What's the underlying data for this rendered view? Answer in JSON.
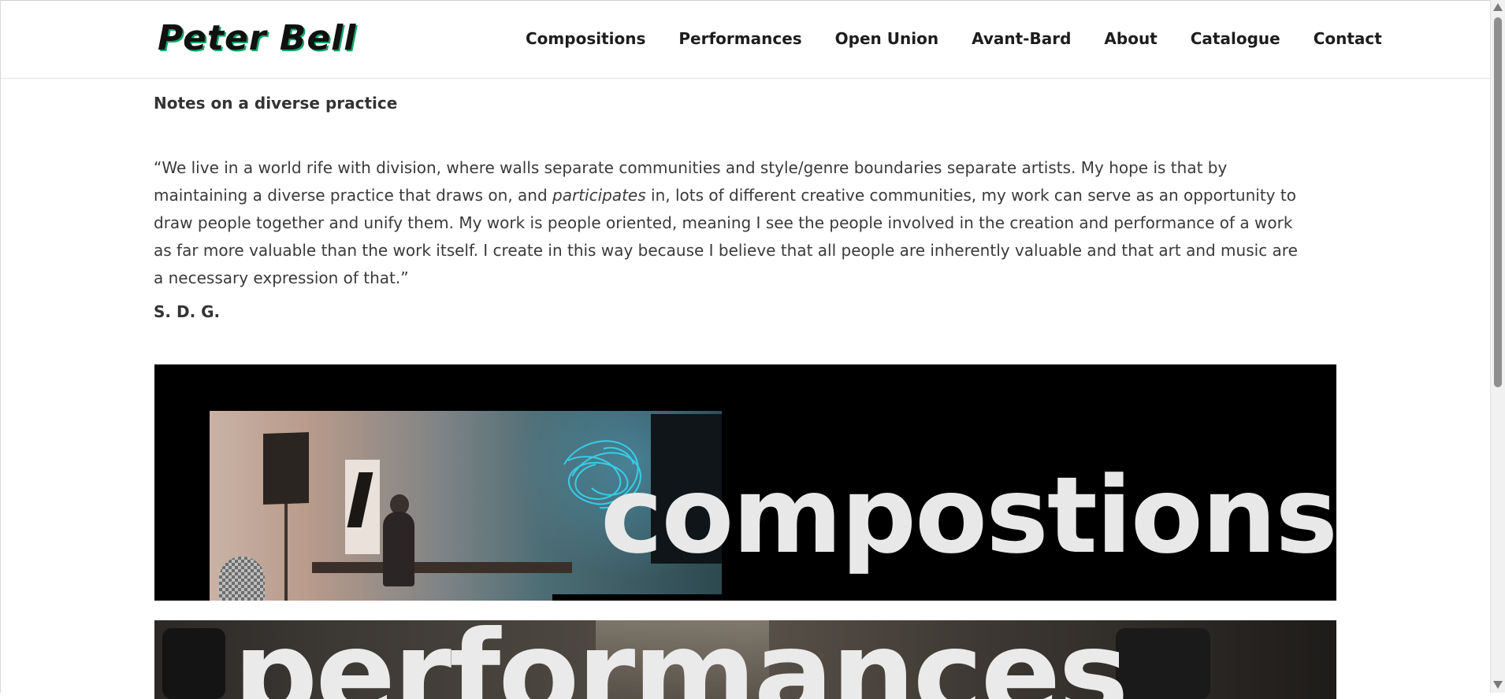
{
  "header": {
    "logo": "Peter Bell",
    "nav": [
      "Compositions",
      "Performances",
      "Open Union",
      "Avant-Bard",
      "About",
      "Catalogue",
      "Contact"
    ]
  },
  "content": {
    "subheading": "Notes on a diverse practice",
    "quote_part1": "“We live in a world rife with division, where walls separate communities and style/genre boundaries separate artists. My hope is that by maintaining a diverse practice that draws on, and ",
    "quote_em": "participates",
    "quote_part2": " in, lots of different creative communities, my work can serve as an opportunity to draw people together and unify them. My work is people oriented, meaning I see the people involved in the creation and performance of a work as far more valuable than the work itself. I create in this way because I believe that all people are inherently valuable and that art and music are a necessary expression of that.”",
    "signature": "S. D. G."
  },
  "panels": {
    "compositions_label": "compostions",
    "performances_label": "performances"
  },
  "colors": {
    "logo_shadow": "#0aa86a",
    "panel_bg": "#000000",
    "panel_text": "#e8e8e8",
    "laser": "#36d7f2"
  }
}
